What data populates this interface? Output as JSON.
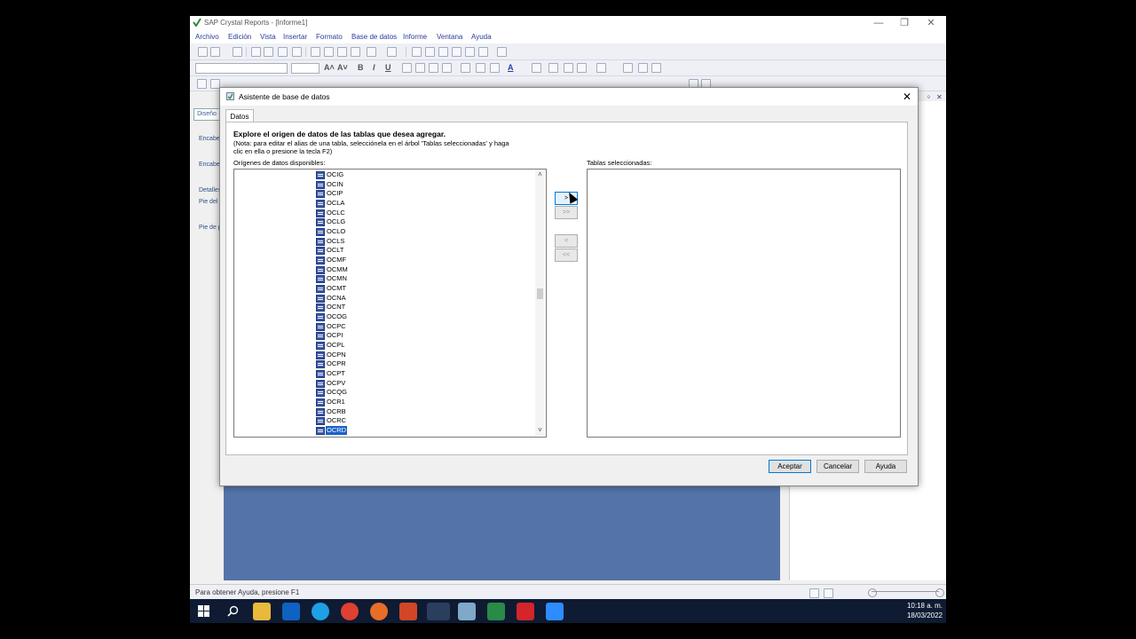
{
  "app": {
    "title": "SAP Crystal Reports - [Informe1]",
    "window_controls": {
      "minimize": "—",
      "maximize": "❐",
      "close": "✕"
    },
    "menu": [
      "Archivo",
      "Edición",
      "Vista",
      "Insertar",
      "Formato",
      "Base de datos",
      "Informe",
      "Ventana",
      "Ayuda"
    ],
    "toolbar_glyphs": {
      "font_grow": "A˄",
      "font_shrink": "A˅",
      "bold": "B",
      "italic": "I",
      "underline": "U",
      "font_color": "A"
    },
    "design_tab": "Diseño",
    "sections": [
      "Encabe",
      "Encabe",
      "Detalles",
      "Pie del",
      "Pie de p"
    ],
    "panel_controls": {
      "pin": "ᛜ",
      "close": "✕"
    },
    "status_text": "Para obtener Ayuda, presione F1"
  },
  "dialog": {
    "title": "Asistente de base de datos",
    "close": "✕",
    "tab": "Datos",
    "instruction_title": "Explore el origen de datos de las tablas que desea agregar.",
    "instruction_note_line1": "(Nota: para editar el alias de una tabla, selecciónela en el árbol 'Tablas seleccionadas' y haga",
    "instruction_note_line2": "clic en ella o presione la tecla F2)",
    "available_label": "Orígenes de datos disponibles:",
    "selected_label": "Tablas seleccionadas:",
    "available_tables": [
      "OCIG",
      "OCIN",
      "OCIP",
      "OCLA",
      "OCLC",
      "OCLG",
      "OCLO",
      "OCLS",
      "OCLT",
      "OCMF",
      "OCMM",
      "OCMN",
      "OCMT",
      "OCNA",
      "OCNT",
      "OCOG",
      "OCPC",
      "OCPI",
      "OCPL",
      "OCPN",
      "OCPR",
      "OCPT",
      "OCPV",
      "OCQG",
      "OCR1",
      "OCRB",
      "OCRC",
      "OCRD"
    ],
    "selected_table": "OCRD",
    "selected_tables": [],
    "scroll": {
      "up": "˄",
      "down": "˅"
    },
    "transfer_buttons": {
      "add": ">",
      "add_all": ">>",
      "remove": "<",
      "remove_all": "<<"
    },
    "buttons": {
      "ok": "Aceptar",
      "cancel": "Cancelar",
      "help": "Ayuda"
    }
  },
  "taskbar": {
    "apps": [
      "start",
      "search",
      "file-explorer",
      "outlook",
      "skype",
      "chrome",
      "firefox",
      "powerpoint",
      "crystal-reports",
      "notepad",
      "sap",
      "acrobat",
      "zoom"
    ],
    "time": "10:18 a. m.",
    "date": "18/03/2022"
  },
  "colors": {
    "design_background": "#5474a8",
    "selection": "#1a62c8",
    "menu_text": "#2a3c9c",
    "taskbar": "#0e1b33"
  }
}
